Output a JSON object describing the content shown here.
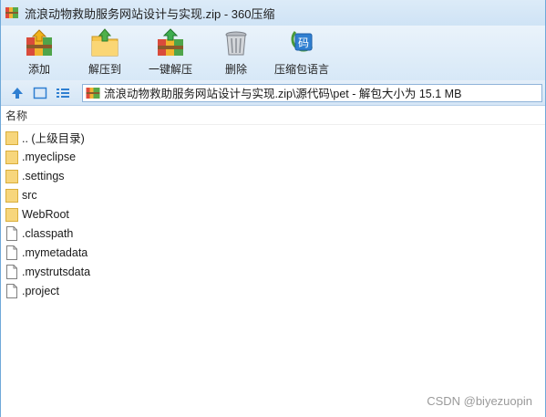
{
  "window": {
    "title": "流浪动物救助服务网站设计与实现.zip - 360压缩"
  },
  "toolbar": {
    "buttons": [
      {
        "label": "添加",
        "icon": "add-archive-icon"
      },
      {
        "label": "解压到",
        "icon": "extract-to-icon"
      },
      {
        "label": "一键解压",
        "icon": "one-click-extract-icon"
      },
      {
        "label": "删除",
        "icon": "trash-icon"
      },
      {
        "label": "压缩包语言",
        "icon": "archive-language-icon"
      }
    ]
  },
  "address": {
    "path": "流浪动物救助服务网站设计与实现.zip\\源代码\\pet - 解包大小为 15.1 MB"
  },
  "list": {
    "column_name": "名称",
    "items": [
      {
        "name": ".. (上级目录)",
        "type": "folder"
      },
      {
        "name": ".myeclipse",
        "type": "folder"
      },
      {
        "name": ".settings",
        "type": "folder"
      },
      {
        "name": "src",
        "type": "folder"
      },
      {
        "name": "WebRoot",
        "type": "folder"
      },
      {
        "name": ".classpath",
        "type": "file"
      },
      {
        "name": ".mymetadata",
        "type": "file"
      },
      {
        "name": ".mystrutsdata",
        "type": "file"
      },
      {
        "name": ".project",
        "type": "file"
      }
    ]
  },
  "watermark": "CSDN @biyezuopin",
  "colors": {
    "folder": "#f5cf6a",
    "accent_blue": "#2f7fd1"
  }
}
